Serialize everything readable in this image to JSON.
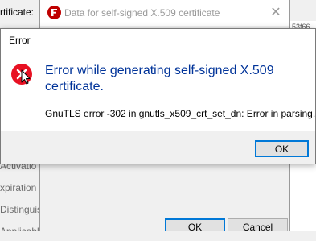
{
  "background_window": {
    "labels": [
      "rtificate:",
      "Activatio",
      "xpiration",
      "Distinguish",
      "Applicable"
    ],
    "strip_text": "53f66"
  },
  "data_dialog": {
    "title": "Data for self-signed X.509 certificate",
    "close_glyph": "✕",
    "ok_label": "OK",
    "cancel_label": "Cancel"
  },
  "error_dialog": {
    "title": "Error",
    "heading": "Error while generating self-signed X.509 certificate.",
    "detail": "GnuTLS error -302 in gnutls_x509_crt_set_dn: Error in parsing.",
    "ok_label": "OK"
  },
  "colors": {
    "accent": "#0078d7",
    "heading": "#003399",
    "error_icon": "#e81123",
    "filezilla_red": "#bf0000"
  },
  "icons": [
    "filezilla-icon",
    "close-icon",
    "error-icon"
  ]
}
